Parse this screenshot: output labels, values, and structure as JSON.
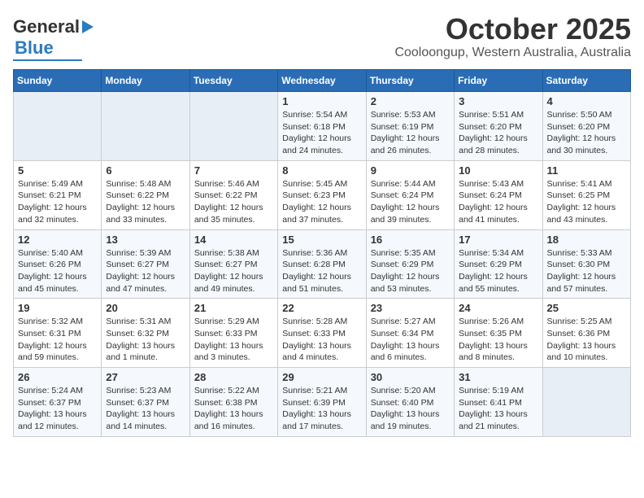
{
  "header": {
    "logo_line1": "General",
    "logo_line2": "Blue",
    "title": "October 2025",
    "subtitle": "Cooloongup, Western Australia, Australia"
  },
  "weekdays": [
    "Sunday",
    "Monday",
    "Tuesday",
    "Wednesday",
    "Thursday",
    "Friday",
    "Saturday"
  ],
  "weeks": [
    [
      {
        "day": "",
        "detail": ""
      },
      {
        "day": "",
        "detail": ""
      },
      {
        "day": "",
        "detail": ""
      },
      {
        "day": "1",
        "detail": "Sunrise: 5:54 AM\nSunset: 6:18 PM\nDaylight: 12 hours\nand 24 minutes."
      },
      {
        "day": "2",
        "detail": "Sunrise: 5:53 AM\nSunset: 6:19 PM\nDaylight: 12 hours\nand 26 minutes."
      },
      {
        "day": "3",
        "detail": "Sunrise: 5:51 AM\nSunset: 6:20 PM\nDaylight: 12 hours\nand 28 minutes."
      },
      {
        "day": "4",
        "detail": "Sunrise: 5:50 AM\nSunset: 6:20 PM\nDaylight: 12 hours\nand 30 minutes."
      }
    ],
    [
      {
        "day": "5",
        "detail": "Sunrise: 5:49 AM\nSunset: 6:21 PM\nDaylight: 12 hours\nand 32 minutes."
      },
      {
        "day": "6",
        "detail": "Sunrise: 5:48 AM\nSunset: 6:22 PM\nDaylight: 12 hours\nand 33 minutes."
      },
      {
        "day": "7",
        "detail": "Sunrise: 5:46 AM\nSunset: 6:22 PM\nDaylight: 12 hours\nand 35 minutes."
      },
      {
        "day": "8",
        "detail": "Sunrise: 5:45 AM\nSunset: 6:23 PM\nDaylight: 12 hours\nand 37 minutes."
      },
      {
        "day": "9",
        "detail": "Sunrise: 5:44 AM\nSunset: 6:24 PM\nDaylight: 12 hours\nand 39 minutes."
      },
      {
        "day": "10",
        "detail": "Sunrise: 5:43 AM\nSunset: 6:24 PM\nDaylight: 12 hours\nand 41 minutes."
      },
      {
        "day": "11",
        "detail": "Sunrise: 5:41 AM\nSunset: 6:25 PM\nDaylight: 12 hours\nand 43 minutes."
      }
    ],
    [
      {
        "day": "12",
        "detail": "Sunrise: 5:40 AM\nSunset: 6:26 PM\nDaylight: 12 hours\nand 45 minutes."
      },
      {
        "day": "13",
        "detail": "Sunrise: 5:39 AM\nSunset: 6:27 PM\nDaylight: 12 hours\nand 47 minutes."
      },
      {
        "day": "14",
        "detail": "Sunrise: 5:38 AM\nSunset: 6:27 PM\nDaylight: 12 hours\nand 49 minutes."
      },
      {
        "day": "15",
        "detail": "Sunrise: 5:36 AM\nSunset: 6:28 PM\nDaylight: 12 hours\nand 51 minutes."
      },
      {
        "day": "16",
        "detail": "Sunrise: 5:35 AM\nSunset: 6:29 PM\nDaylight: 12 hours\nand 53 minutes."
      },
      {
        "day": "17",
        "detail": "Sunrise: 5:34 AM\nSunset: 6:29 PM\nDaylight: 12 hours\nand 55 minutes."
      },
      {
        "day": "18",
        "detail": "Sunrise: 5:33 AM\nSunset: 6:30 PM\nDaylight: 12 hours\nand 57 minutes."
      }
    ],
    [
      {
        "day": "19",
        "detail": "Sunrise: 5:32 AM\nSunset: 6:31 PM\nDaylight: 12 hours\nand 59 minutes."
      },
      {
        "day": "20",
        "detail": "Sunrise: 5:31 AM\nSunset: 6:32 PM\nDaylight: 13 hours\nand 1 minute."
      },
      {
        "day": "21",
        "detail": "Sunrise: 5:29 AM\nSunset: 6:33 PM\nDaylight: 13 hours\nand 3 minutes."
      },
      {
        "day": "22",
        "detail": "Sunrise: 5:28 AM\nSunset: 6:33 PM\nDaylight: 13 hours\nand 4 minutes."
      },
      {
        "day": "23",
        "detail": "Sunrise: 5:27 AM\nSunset: 6:34 PM\nDaylight: 13 hours\nand 6 minutes."
      },
      {
        "day": "24",
        "detail": "Sunrise: 5:26 AM\nSunset: 6:35 PM\nDaylight: 13 hours\nand 8 minutes."
      },
      {
        "day": "25",
        "detail": "Sunrise: 5:25 AM\nSunset: 6:36 PM\nDaylight: 13 hours\nand 10 minutes."
      }
    ],
    [
      {
        "day": "26",
        "detail": "Sunrise: 5:24 AM\nSunset: 6:37 PM\nDaylight: 13 hours\nand 12 minutes."
      },
      {
        "day": "27",
        "detail": "Sunrise: 5:23 AM\nSunset: 6:37 PM\nDaylight: 13 hours\nand 14 minutes."
      },
      {
        "day": "28",
        "detail": "Sunrise: 5:22 AM\nSunset: 6:38 PM\nDaylight: 13 hours\nand 16 minutes."
      },
      {
        "day": "29",
        "detail": "Sunrise: 5:21 AM\nSunset: 6:39 PM\nDaylight: 13 hours\nand 17 minutes."
      },
      {
        "day": "30",
        "detail": "Sunrise: 5:20 AM\nSunset: 6:40 PM\nDaylight: 13 hours\nand 19 minutes."
      },
      {
        "day": "31",
        "detail": "Sunrise: 5:19 AM\nSunset: 6:41 PM\nDaylight: 13 hours\nand 21 minutes."
      },
      {
        "day": "",
        "detail": ""
      }
    ]
  ]
}
